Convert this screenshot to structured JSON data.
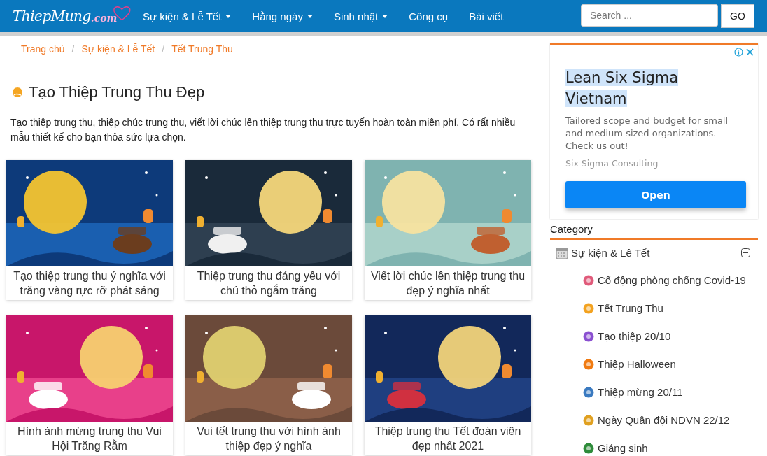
{
  "logo": {
    "name": "ThiepMung",
    "suffix": ".com"
  },
  "nav": [
    {
      "label": "Sự kiện & Lễ Tết",
      "dropdown": true
    },
    {
      "label": "Hằng ngày",
      "dropdown": true
    },
    {
      "label": "Sinh nhật",
      "dropdown": true
    },
    {
      "label": "Công cụ",
      "dropdown": false
    },
    {
      "label": "Bài viết",
      "dropdown": false
    }
  ],
  "search": {
    "placeholder": "Search ...",
    "button": "GO"
  },
  "breadcrumb": [
    "Trang chủ",
    "Sự kiện & Lễ Tết",
    "Tết Trung Thu"
  ],
  "breadcrumb_separator": "/",
  "page_title": "Tạo Thiệp Trung Thu Đẹp",
  "description": "Tạo thiệp trung thu, thiệp chúc trung thu, viết lời chúc lên thiệp trung thu trực tuyến hoàn toàn miễn phí. Có rất nhiều mẫu thiết kế cho bạn thỏa sức lựa chọn.",
  "cards": [
    {
      "caption": "Tạo thiệp trung thu ý nghĩa với trăng vàng rực rỡ phát sáng"
    },
    {
      "caption": "Thiệp trung thu đáng yêu với chú thỏ ngắm trăng"
    },
    {
      "caption": "Viết lời chúc lên thiệp trung thu đẹp ý nghĩa nhất"
    },
    {
      "caption": "Hình ảnh mừng trung thu Vui Hội Trăng Rằm"
    },
    {
      "caption": "Vui tết trung thu với hình ảnh thiệp đẹp ý nghĩa"
    },
    {
      "caption": "Thiệp trung thu Tết đoàn viên đẹp nhất 2021"
    }
  ],
  "ad": {
    "title": "Lean Six Sigma Vietnam",
    "text": "Tailored scope and budget for small and medium sized organizations. Check us out!",
    "advertiser": "Six Sigma Consulting",
    "button": "Open"
  },
  "category": {
    "heading": "Category",
    "items": [
      {
        "label": "Sự kiện & Lễ Tết",
        "expanded": true,
        "children": [
          {
            "label": "Cổ động phòng chống Covid-19"
          },
          {
            "label": "Tết Trung Thu"
          },
          {
            "label": "Tạo thiệp 20/10"
          },
          {
            "label": "Thiệp Halloween"
          },
          {
            "label": "Thiệp mừng 20/11"
          },
          {
            "label": "Ngày Quân đội NDVN 22/12"
          },
          {
            "label": "Giáng sinh"
          }
        ]
      }
    ]
  }
}
